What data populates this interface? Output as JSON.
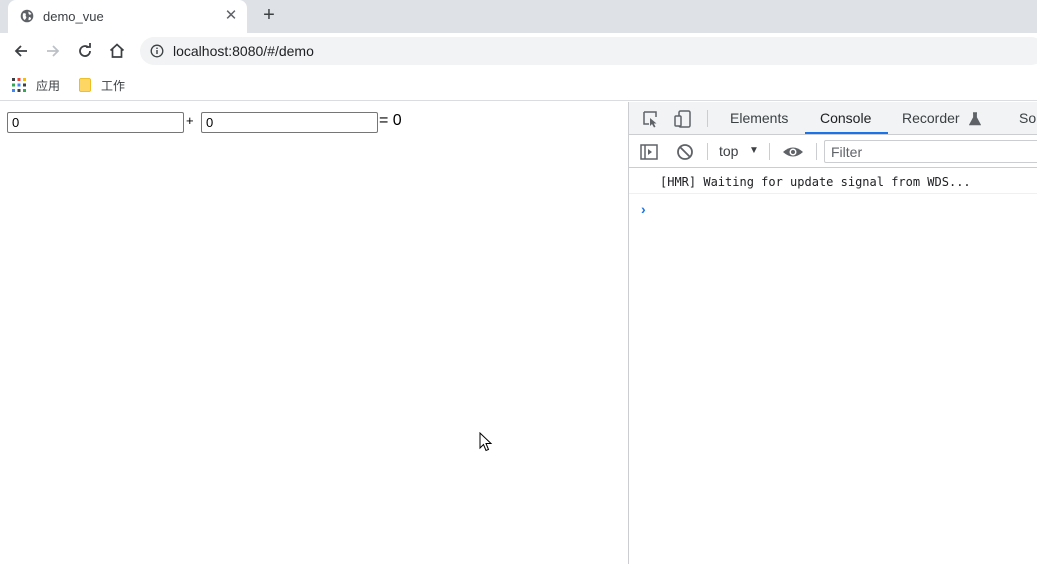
{
  "browser": {
    "tab": {
      "title": "demo_vue",
      "favicon": "globe-icon",
      "close_glyph": "✕"
    },
    "new_tab_glyph": "+",
    "omnibox": {
      "url": "localhost:8080/#/demo"
    },
    "bookmarks": [
      {
        "label": "应用",
        "icon": "apps-grid-icon"
      },
      {
        "label": "工作",
        "icon": "folder-icon"
      }
    ]
  },
  "page": {
    "input_a": "0",
    "plus": "+",
    "input_b": "0",
    "equals": "= 0"
  },
  "devtools": {
    "tabs": [
      "Elements",
      "Console",
      "Recorder",
      "So"
    ],
    "active_tab": "Console",
    "context": "top",
    "filter_placeholder": "Filter",
    "log": "[HMR] Waiting for update signal from WDS...",
    "prompt": "›",
    "accent_color": "#1a73e8"
  }
}
